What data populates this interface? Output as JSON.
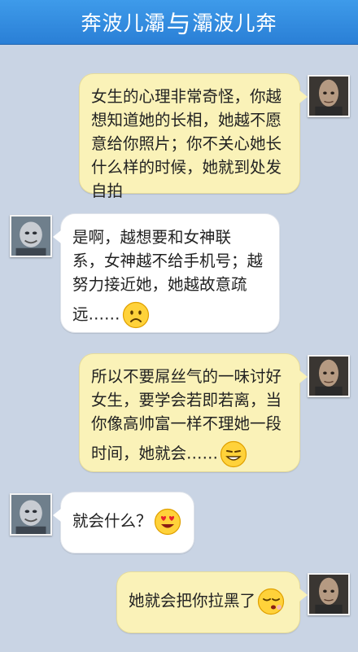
{
  "header": {
    "left": "奔波儿灞",
    "sep": "与",
    "right": "灞波儿奔"
  },
  "messages": [
    {
      "lines": [
        "女生的心理非常奇怪，你越",
        "想知道她的长相，她越不愿",
        "意给你照片；你不关心她长",
        "什么样的时候，她就到处发",
        "自拍"
      ]
    },
    {
      "lines": [
        "是啊，越想要和女神联",
        "系，女神越不给手机号；越",
        "努力接近她，她越故意疏",
        "远……"
      ],
      "emoji": "sad-face"
    },
    {
      "lines": [
        "所以不要屌丝气的一味讨好",
        "女生，要学会若即若离，当",
        "你像高帅富一样不理她一段",
        "时间，她就会……"
      ],
      "emoji": "smug-face"
    },
    {
      "lines": [
        "就会什么？"
      ],
      "emoji": "heart-eyes-face"
    },
    {
      "lines": [
        "她就会把你拉黑了"
      ],
      "emoji": "sleepy-face"
    }
  ],
  "colors": {
    "header": "#2a7fd6",
    "background": "#c9d4e4",
    "bubble_right": "#faf2b8",
    "bubble_left": "#ffffff"
  }
}
